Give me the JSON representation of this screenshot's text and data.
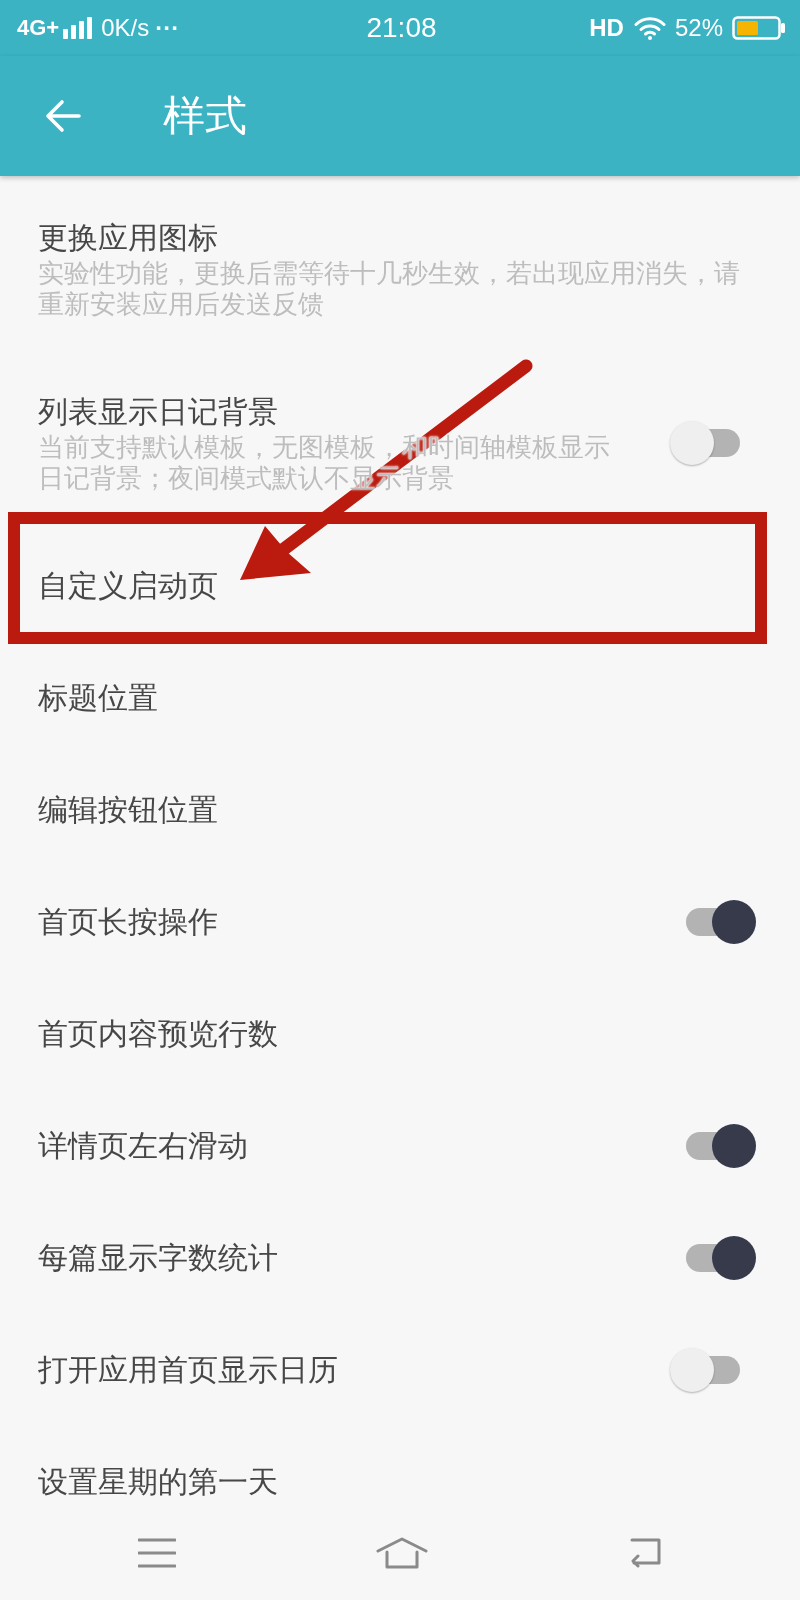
{
  "status_bar": {
    "network": "4G+",
    "speed": "0K/s",
    "more": "···",
    "time": "21:08",
    "hd": "HD",
    "battery": "52%"
  },
  "app_bar": {
    "title": "样式"
  },
  "items": [
    {
      "title": "更换应用图标",
      "subtitle": "实验性功能，更换后需等待十几秒生效，若出现应用消失，请重新安装应用后发送反馈",
      "kind": "plain",
      "highlighted": false
    },
    {
      "title": "列表显示日记背景",
      "subtitle": "当前支持默认模板，无图模板，和时间轴模板显示日记背景；夜间模式默认不显示背景",
      "kind": "toggle",
      "on": false,
      "highlighted": false
    },
    {
      "title": "自定义启动页",
      "kind": "plain",
      "highlighted": true
    },
    {
      "title": "标题位置",
      "kind": "plain",
      "highlighted": false
    },
    {
      "title": "编辑按钮位置",
      "kind": "plain",
      "highlighted": false
    },
    {
      "title": "首页长按操作",
      "kind": "toggle",
      "on": true,
      "highlighted": false
    },
    {
      "title": "首页内容预览行数",
      "kind": "plain",
      "highlighted": false
    },
    {
      "title": "详情页左右滑动",
      "kind": "toggle",
      "on": true,
      "highlighted": false
    },
    {
      "title": "每篇显示字数统计",
      "kind": "toggle",
      "on": true,
      "highlighted": false
    },
    {
      "title": "打开应用首页显示日历",
      "kind": "toggle",
      "on": false,
      "highlighted": false
    },
    {
      "title": "设置星期的第一天",
      "kind": "plain",
      "highlighted": false
    }
  ]
}
